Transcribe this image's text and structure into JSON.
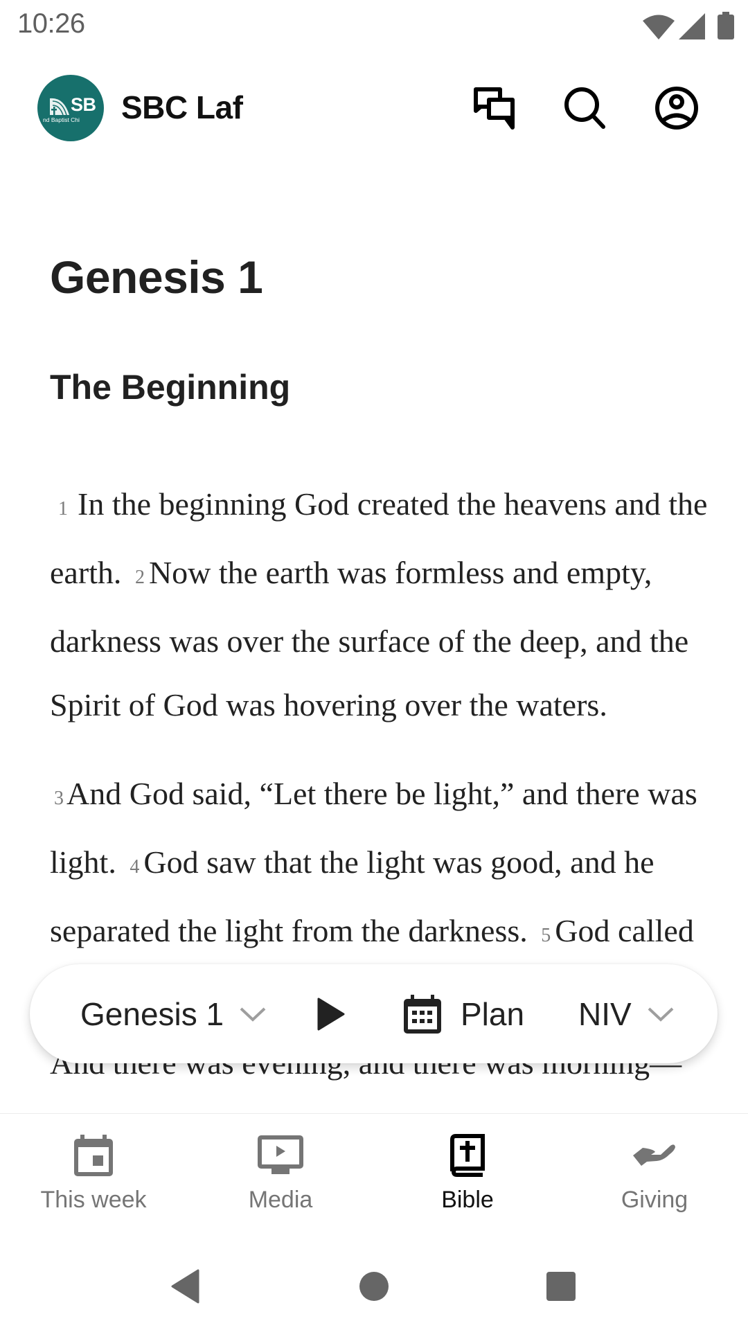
{
  "status_bar": {
    "time": "10:26",
    "icons": [
      "wifi-icon",
      "cell-signal-icon",
      "battery-icon"
    ]
  },
  "header": {
    "logo": {
      "initials": "SB",
      "subtitle": "nd Baptist Chi",
      "color": "#17706c"
    },
    "title": "SBC Laf",
    "actions": [
      "chat-icon",
      "search-icon",
      "account-icon"
    ]
  },
  "reader": {
    "chapter_title": "Genesis 1",
    "section_title": "The Beginning",
    "paragraphs": [
      {
        "verses": [
          {
            "num": "1",
            "text": "In the beginning God created the heavens and the earth."
          },
          {
            "num": "2",
            "text": "Now the earth was formless and empty, darkness was over the surface of the deep, and the Spirit of God was hovering over the waters."
          }
        ]
      },
      {
        "verses": [
          {
            "num": "3",
            "text": "And God said, “Let there be light,” and there was light."
          },
          {
            "num": "4",
            "text": "God saw that the light was good, and he separated the light from the darkness."
          },
          {
            "num": "5",
            "text": "God called the light “day,” and the darkness he called “night.” And there was evening, and there was morning—the first day."
          }
        ]
      }
    ]
  },
  "reader_bar": {
    "book_selector": "Genesis 1",
    "play_icon": "play-icon",
    "plan_label": "Plan",
    "version_selector": "NIV"
  },
  "bottom_nav": {
    "tabs": [
      {
        "label": "This week",
        "icon": "calendar-icon",
        "active": false
      },
      {
        "label": "Media",
        "icon": "tv-play-icon",
        "active": false
      },
      {
        "label": "Bible",
        "icon": "bible-icon",
        "active": true
      },
      {
        "label": "Giving",
        "icon": "giving-hand-icon",
        "active": false
      }
    ]
  },
  "colors": {
    "brand_teal": "#17706c",
    "text_primary": "#222222",
    "text_secondary": "#757575",
    "verse_number": "#7a7a7a"
  }
}
